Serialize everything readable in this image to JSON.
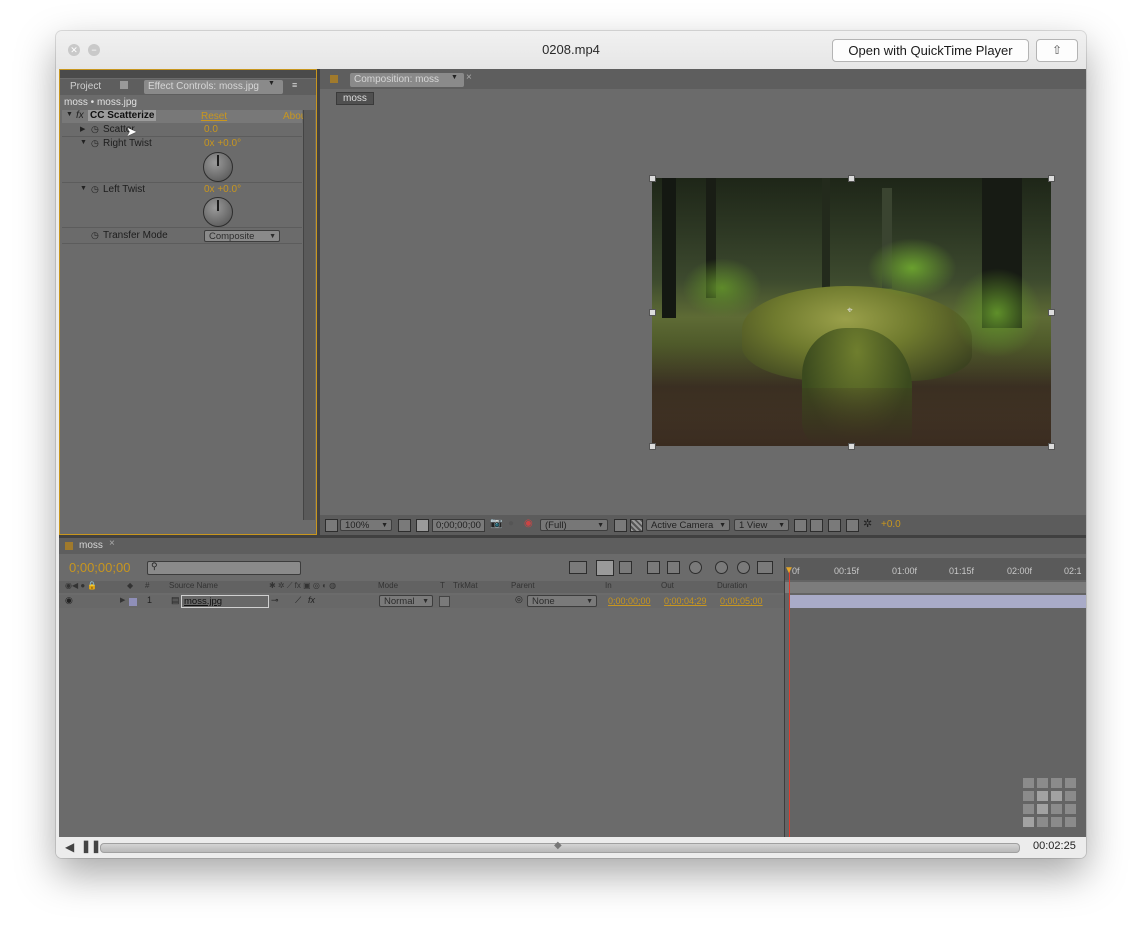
{
  "window": {
    "title": "0208.mp4",
    "open_button": "Open with QuickTime Player",
    "share_icon": "share-icon"
  },
  "effect_panel": {
    "tabs": [
      "Project",
      "Effect Controls: moss.jpg"
    ],
    "breadcrumb": "moss • moss.jpg",
    "effect_name": "CC Scatterize",
    "reset": "Reset",
    "about": "Abou",
    "fx": "fx",
    "props": [
      {
        "name": "Scatter",
        "value": "0.0"
      },
      {
        "name": "Right Twist",
        "value": "0x +0.0°"
      },
      {
        "name": "Left Twist",
        "value": "0x +0.0°"
      },
      {
        "name": "Transfer Mode",
        "value": "Composite"
      }
    ]
  },
  "composition": {
    "tab": "Composition: moss",
    "chip": "moss",
    "zoom": "100%",
    "timecode": "0;00;00;00",
    "resolution": "(Full)",
    "camera": "Active Camera",
    "views": "1 View",
    "exposure": "+0.0"
  },
  "timeline": {
    "tab": "moss",
    "timecode": "0;00;00;00",
    "columns": [
      "#",
      "Source Name",
      "Mode",
      "T",
      "TrkMat",
      "Parent",
      "In",
      "Out",
      "Duration"
    ],
    "layer": {
      "index": "1",
      "source": "moss.jpg",
      "mode": "Normal",
      "parent": "None",
      "in": "0;00;00;00",
      "out": "0;00;04;29",
      "duration": "0;00;05;00"
    },
    "ruler": [
      "0f",
      "00:15f",
      "01:00f",
      "01:15f",
      "02:00f",
      "02:1"
    ]
  },
  "player": {
    "time": "00:02:25",
    "progress": 0.5
  }
}
